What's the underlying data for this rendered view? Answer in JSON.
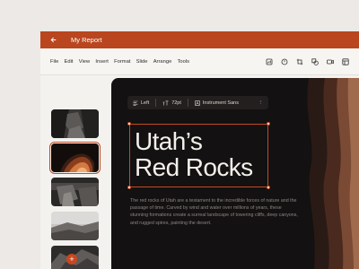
{
  "titlebar": {
    "title": "My Report",
    "back_icon": "arrow-left-icon"
  },
  "menu": [
    "File",
    "Edit",
    "View",
    "Insert",
    "Format",
    "Slide",
    "Arrange",
    "Tools"
  ],
  "tools": [
    "chart-icon",
    "timer-icon",
    "crop-icon",
    "shapes-icon",
    "video-icon",
    "table-icon"
  ],
  "slides": [
    {
      "name": "slide-1",
      "selected": false
    },
    {
      "name": "slide-2",
      "selected": true
    },
    {
      "name": "slide-3",
      "selected": false
    },
    {
      "name": "slide-4",
      "selected": false
    },
    {
      "name": "slide-5",
      "selected": false
    }
  ],
  "add_slide": {
    "label": "+"
  },
  "format_toolbar": {
    "align": "Left",
    "size": "72pt",
    "font": "Instrument Sans",
    "more": "⋮"
  },
  "slide": {
    "heading_line1": "Utah’s",
    "heading_line2": "Red Rocks",
    "body": "The red rocks of Utah are a testament to the incredible forces of nature and the passage of time. Carved by wind and water over millions of years, these stunning formations create a surreal landscape of towering cliffs, deep canyons, and rugged spires, painting the desert."
  },
  "colors": {
    "accent": "#b9461e",
    "canvas": "#131111"
  }
}
